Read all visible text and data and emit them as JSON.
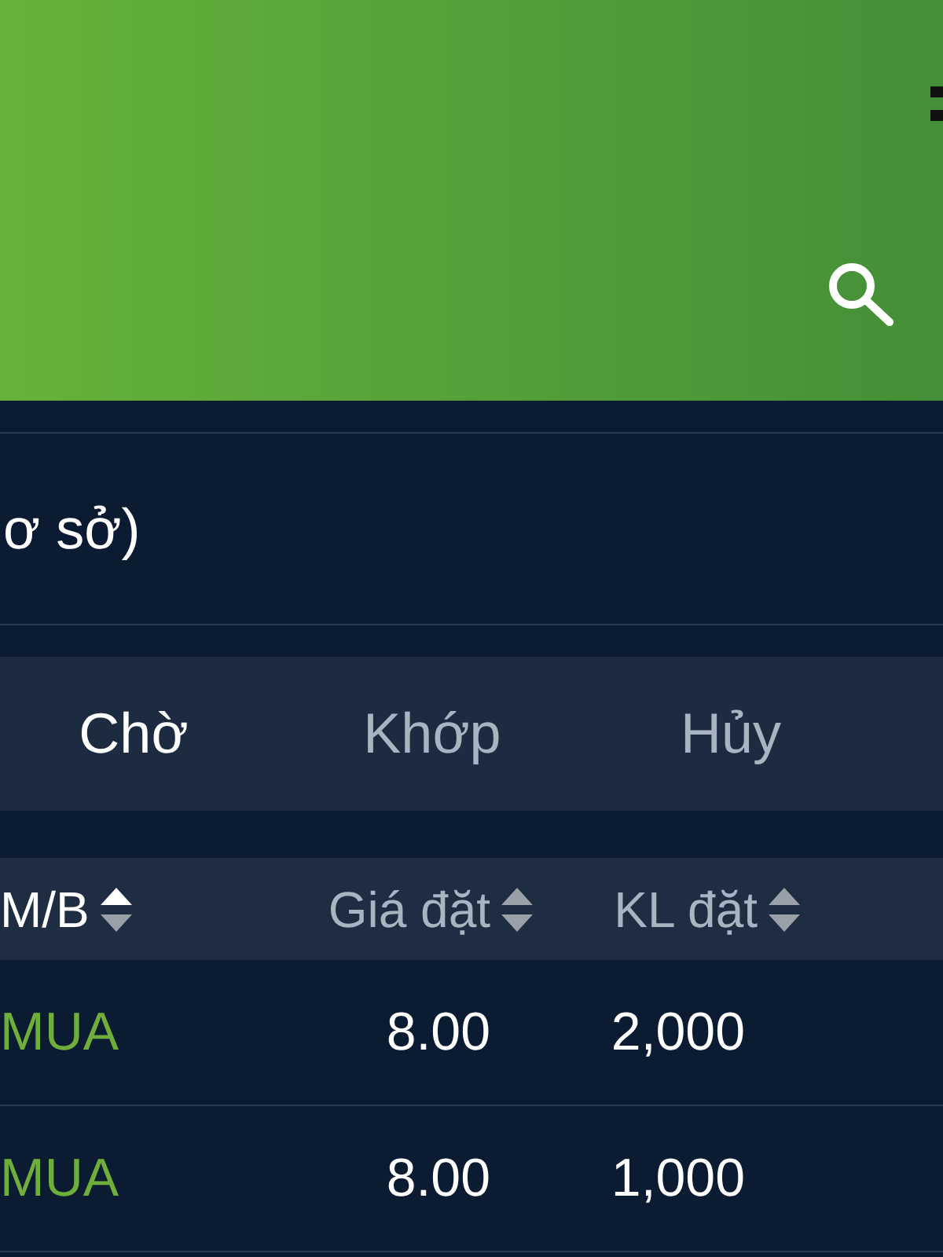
{
  "header": {
    "title_fragment": "ơ sở)"
  },
  "tabs": [
    {
      "label": "Chờ",
      "selected": true
    },
    {
      "label": "Khớp",
      "selected": false
    },
    {
      "label": "Hủy",
      "selected": false
    }
  ],
  "table": {
    "columns": [
      {
        "label": "M/B",
        "sorted": true
      },
      {
        "label": "Giá đặt",
        "sorted": false
      },
      {
        "label": "KL đặt",
        "sorted": false
      }
    ],
    "rows": [
      {
        "side": "MUA",
        "price": "8.00",
        "quantity": "2,000"
      },
      {
        "side": "MUA",
        "price": "8.00",
        "quantity": "1,000"
      }
    ]
  }
}
